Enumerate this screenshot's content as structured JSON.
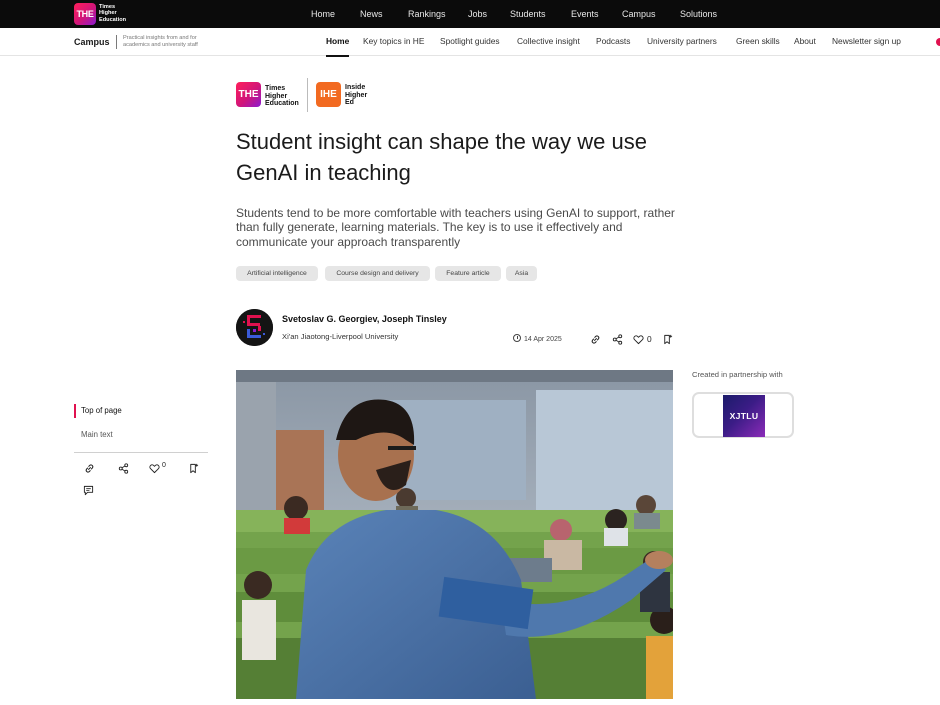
{
  "topbar": {
    "logo_mark": "THE",
    "logo_text": [
      "Times",
      "Higher",
      "Education"
    ],
    "nav": [
      "Home",
      "News",
      "Rankings",
      "Jobs",
      "Students",
      "Events",
      "Campus",
      "Solutions"
    ]
  },
  "subbar": {
    "section": "Campus",
    "tagline": [
      "Practical insights from and for",
      "academics and university staff"
    ],
    "nav": [
      "Home",
      "Key topics in HE",
      "Spotlight guides",
      "Collective insight",
      "Podcasts",
      "University partners",
      "Green skills",
      "About",
      "Newsletter sign up"
    ],
    "active": "Home"
  },
  "brands": {
    "the_mark": "THE",
    "the_text": [
      "Times",
      "Higher",
      "Education"
    ],
    "ihe_mark": "IHE",
    "ihe_text": [
      "Inside",
      "Higher",
      "Ed"
    ]
  },
  "article": {
    "headline": "Student insight can shape the way we use GenAI in teaching",
    "standfirst": "Students tend to be more comfortable with teachers using GenAI to support, rather than fully generate, learning materials. The key is to use it effectively and communicate your approach transparently",
    "tags": [
      "Artificial intelligence",
      "Course design and delivery",
      "Feature article",
      "Asia"
    ],
    "authors": "Svetoslav G. Georgiev, Joseph Tinsley",
    "institution": "Xi'an Jiaotong-Liverpool University",
    "date": "14 Apr 2025",
    "like_count": "0",
    "icons": [
      "clock-icon",
      "link-icon",
      "share-icon",
      "heart-icon",
      "bookmark-icon"
    ]
  },
  "partnership": {
    "label": "Created in partnership with",
    "partner_name": "XJTLU"
  },
  "rail": {
    "top_of_page": "Top of page",
    "main_text": "Main text",
    "like_count": "0",
    "icons": [
      "link-icon",
      "share-icon",
      "heart-icon",
      "bookmark-icon",
      "comment-icon"
    ]
  },
  "colors": {
    "accent": "#e0114f",
    "the_gradient_start": "#ff1f5a",
    "the_gradient_end": "#8a1bd1",
    "ihe_orange": "#f26a21",
    "tag_bg": "#e6e6e6",
    "topbar_bg": "#0b0b0b"
  }
}
